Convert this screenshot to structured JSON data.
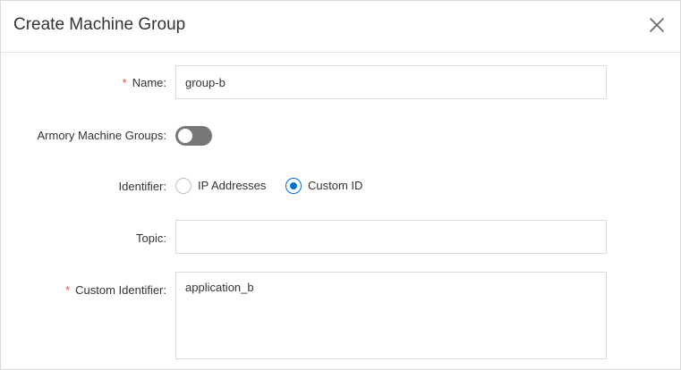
{
  "dialog": {
    "title": "Create Machine Group",
    "close_icon": "close-icon"
  },
  "form": {
    "name": {
      "required_mark": "*",
      "label": "Name:",
      "value": "group-b"
    },
    "armory": {
      "label": "Armory Machine Groups:",
      "enabled": false
    },
    "identifier": {
      "label": "Identifier:",
      "options": [
        {
          "label": "IP Addresses",
          "selected": false
        },
        {
          "label": "Custom ID",
          "selected": true
        }
      ]
    },
    "topic": {
      "label": "Topic:",
      "value": ""
    },
    "custom_identifier": {
      "required_mark": "*",
      "label": "Custom Identifier:",
      "value": "application_b"
    }
  },
  "colors": {
    "accent": "#0070cc",
    "required": "#e84c3d",
    "switch_off": "#777777"
  }
}
